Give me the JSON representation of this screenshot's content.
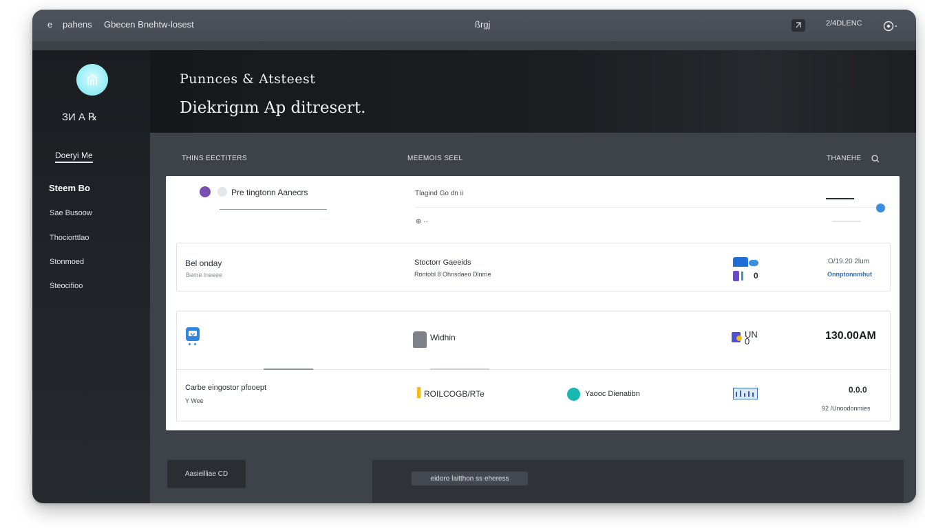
{
  "topbar": {
    "back_icon": "e",
    "nav_left": "pahens",
    "breadcrumb": "Gbecen Bnehtw-losest",
    "center_title": "ßrgj",
    "account_badge": "2/4DLENC",
    "profile_icon": "chart-profile-icon"
  },
  "sidebar": {
    "avatar_icon": "building-icon",
    "user_name": "ЗИ А ℞",
    "section_link": "Doeryi Me",
    "section_title": "Steem Bo",
    "items": [
      {
        "label": "Sae Busoow"
      },
      {
        "label": "Thociorttlao"
      },
      {
        "label": "Stonmoed"
      },
      {
        "label": "Steocifioo"
      }
    ]
  },
  "hero": {
    "title": "Punnces & Atsteest",
    "subtitle": "Diekrigım Ap ditresert."
  },
  "columns": {
    "col1": "THINS EECTITERS",
    "col2": "MEEMOIS SEEL",
    "col3": "THANEHE"
  },
  "panel": {
    "row1": {
      "label": "Pre tingtonn Aanecrs",
      "mid_label": "Tlagind Go dn ii",
      "mid_detail": "⊕ ··"
    },
    "card1": {
      "title": "Bel onday",
      "subtitle": "Beme lneeee",
      "mid_title": "Stoctorr Gaeeids",
      "mid_subtitle": "Rontobl 8 Ohnsdaeo Dlnrne",
      "value": "0",
      "right_top": "O/19.20 2lum",
      "right_link": "Onnptonnmhut"
    },
    "card2": {
      "mid_title": "Widhin",
      "badge": "UN\n0",
      "amount": "130.00AM"
    },
    "card3": {
      "title": "Carbe eingostor pfooept",
      "subtitle": "Y Wee",
      "mid_code": "ROILCOGB/RTe",
      "person": "Yaooc Dienatibn",
      "right_value": "0.0.0",
      "right_sub": "92 /Unoodonmies"
    }
  },
  "bottom": {
    "button": "Aasieilliae CD",
    "status": "eidoro laitthon ss eheress"
  },
  "colors": {
    "accent_blue": "#3b8de0",
    "teal": "#17b8b0",
    "purple": "#7b4fb0",
    "gold": "#f2b81c"
  }
}
